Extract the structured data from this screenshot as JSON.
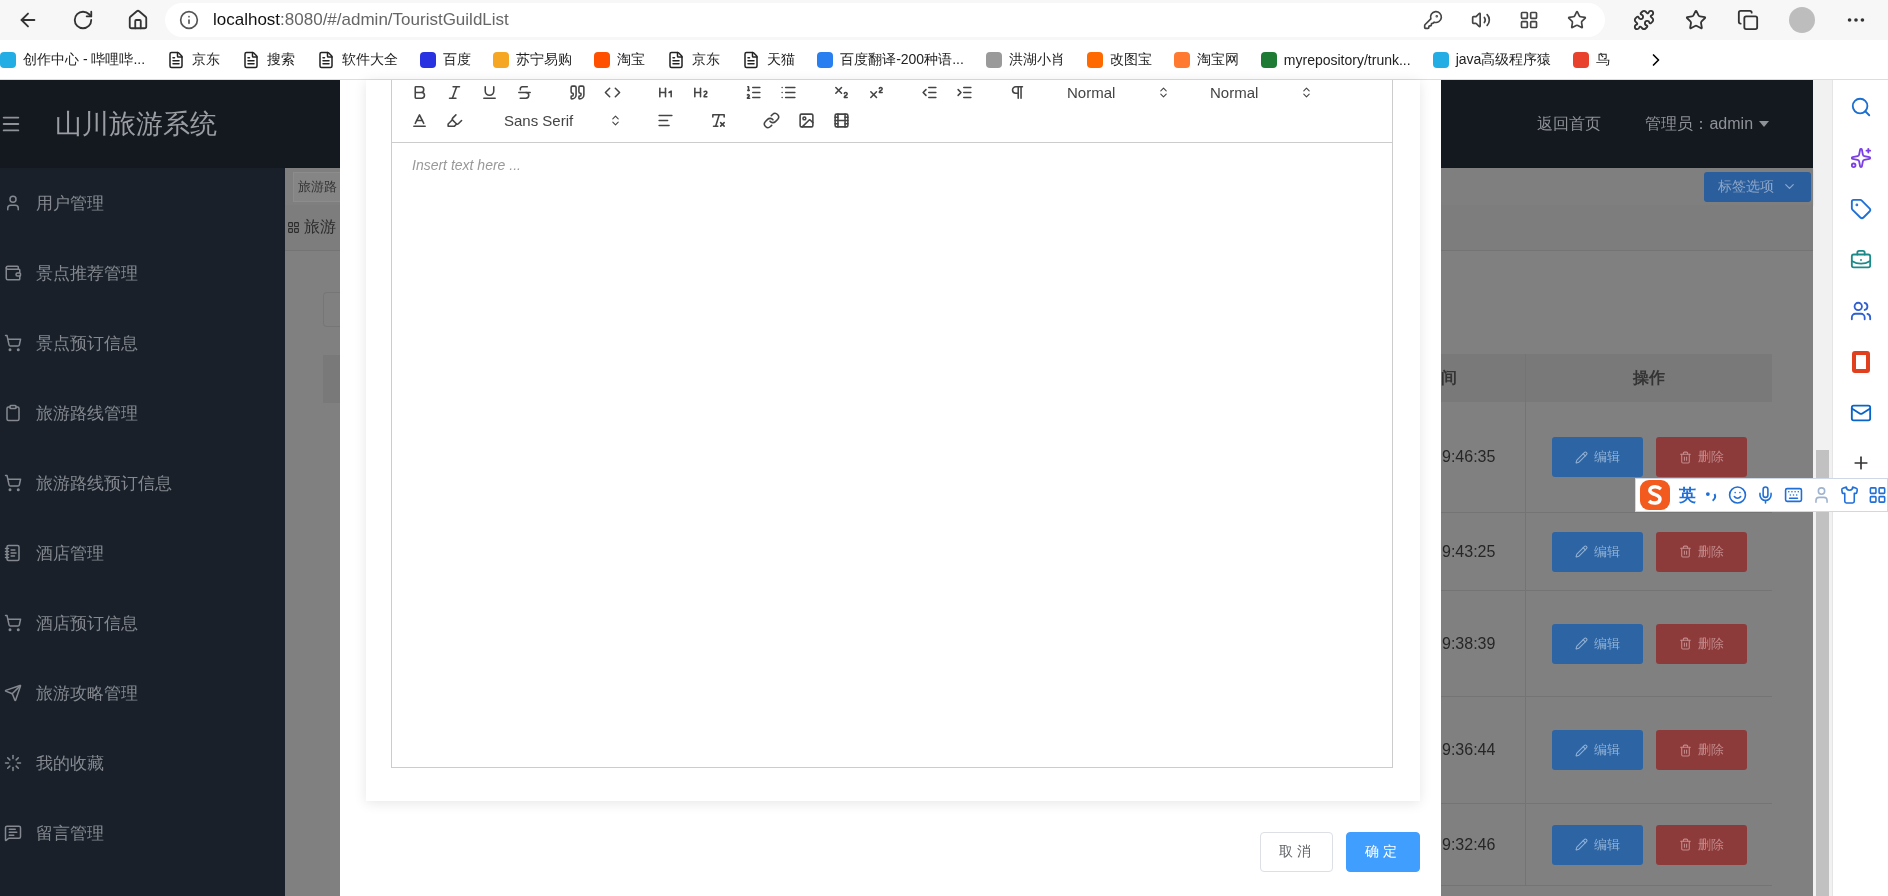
{
  "browser": {
    "address": {
      "host": "localhost",
      "path": ":8080/#/admin/TouristGuildList"
    },
    "bookmarks": [
      {
        "label": "创作中心 - 哔哩哔...",
        "kind": "favicon",
        "color": "#23ade5"
      },
      {
        "label": "京东",
        "kind": "page"
      },
      {
        "label": "搜索",
        "kind": "page"
      },
      {
        "label": "软件大全",
        "kind": "page"
      },
      {
        "label": "百度",
        "kind": "favicon",
        "color": "#2932e1"
      },
      {
        "label": "苏宁易购",
        "kind": "favicon",
        "color": "#f5a623"
      },
      {
        "label": "淘宝",
        "kind": "favicon",
        "color": "#ff5000"
      },
      {
        "label": "京东",
        "kind": "page"
      },
      {
        "label": "天猫",
        "kind": "page"
      },
      {
        "label": "百度翻译-200种语...",
        "kind": "favicon",
        "color": "#2a7ff0"
      },
      {
        "label": "洪湖小肖",
        "kind": "favicon",
        "color": "#9a9a9a"
      },
      {
        "label": "改图宝",
        "kind": "favicon",
        "color": "#ff6a00"
      },
      {
        "label": "淘宝网",
        "kind": "favicon",
        "color": "#ff7a30"
      },
      {
        "label": "myrepository/trunk...",
        "kind": "favicon",
        "color": "#1e7b34"
      },
      {
        "label": "java高级程序猿",
        "kind": "favicon",
        "color": "#23ade5"
      },
      {
        "label": "鸟",
        "kind": "favicon",
        "color": "#e8412c"
      }
    ]
  },
  "app": {
    "title": "山川旅游系统",
    "home_link": "返回首页",
    "user": "管理员：admin"
  },
  "sidebar": {
    "items": [
      "用户管理",
      "景点推荐管理",
      "景点预订信息",
      "旅游路线管理",
      "旅游路线预订信息",
      "酒店管理",
      "酒店预订信息",
      "旅游攻略管理",
      "我的收藏",
      "留言管理"
    ]
  },
  "tab_bar": {
    "tab": "旅游路",
    "options_button": "标签选项"
  },
  "breadcrumb": "旅游",
  "table": {
    "columns": [
      "间",
      "操作"
    ],
    "rows": [
      {
        "time": "9:46:35",
        "edit": "编辑",
        "delete": "删除"
      },
      {
        "time": "9:43:25",
        "edit": "编辑",
        "delete": "删除"
      },
      {
        "time": "9:38:39",
        "edit": "编辑",
        "delete": "删除"
      },
      {
        "time": "9:36:44",
        "edit": "编辑",
        "delete": "删除"
      },
      {
        "time": "9:32:46",
        "edit": "编辑",
        "delete": "删除"
      }
    ]
  },
  "dialog": {
    "editor": {
      "header_select": "Normal",
      "size_select": "Normal",
      "font_select": "Sans Serif",
      "placeholder": "Insert text here ..."
    },
    "cancel_button": "取消",
    "confirm_button": "确定"
  },
  "ime": {
    "mode": "英"
  }
}
